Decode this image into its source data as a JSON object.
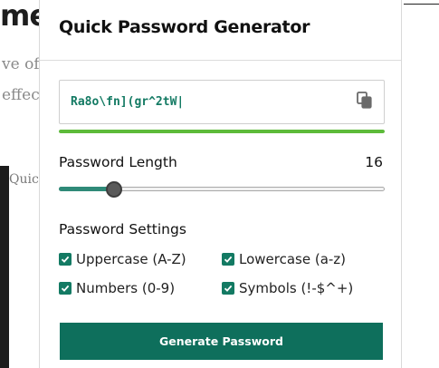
{
  "background_page": {
    "heading_fragment": "me",
    "text_line_1": "ve of p",
    "text_line_2": "effec",
    "caption_fragment": "Quic"
  },
  "popup": {
    "title": "Quick Password Generator",
    "password": {
      "value": "Ra8o\\fn](gr^2tW|",
      "copy_icon": "copy-icon",
      "strength_fraction": 1.0,
      "strength_color": "#5dbb3a"
    },
    "length": {
      "label": "Password Length",
      "value": "16",
      "slider_fraction": 0.17
    },
    "settings": {
      "label": "Password Settings",
      "options": [
        {
          "label": "Uppercase (A-Z)",
          "checked": true
        },
        {
          "label": "Lowercase (a-z)",
          "checked": true
        },
        {
          "label": "Numbers (0-9)",
          "checked": true
        },
        {
          "label": "Symbols (!-$^+)",
          "checked": true
        }
      ]
    },
    "generate_button_label": "Generate Password"
  },
  "colors": {
    "accent": "#0e6f5c",
    "password_text": "#137a63",
    "checkbox": "#137a63"
  }
}
